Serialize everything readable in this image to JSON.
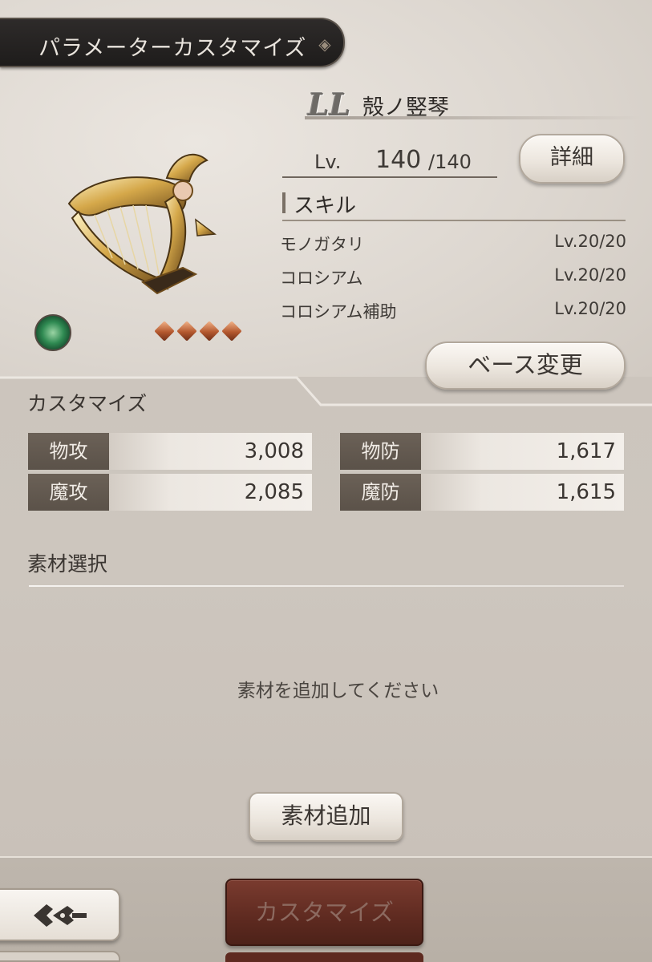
{
  "header": {
    "title": "パラメーターカスタマイズ",
    "icon": "diamond-emblem-icon"
  },
  "item": {
    "rank": "LL",
    "name": "殻ノ竪琴",
    "level_label": "Lv.",
    "level_current": "140",
    "level_max": "/140",
    "element": "wind",
    "stars": 4
  },
  "buttons": {
    "detail": "詳細",
    "base_change": "ベース変更",
    "add_material": "素材追加",
    "customize": "カスタマイズ"
  },
  "skills": {
    "title": "スキル",
    "rows": [
      {
        "name": "モノガタリ",
        "level": "Lv.20/20"
      },
      {
        "name": "コロシアム",
        "level": "Lv.20/20"
      },
      {
        "name": "コロシアム補助",
        "level": "Lv.20/20"
      }
    ]
  },
  "customize": {
    "title": "カスタマイズ",
    "stats": [
      {
        "label": "物攻",
        "value": "3,008"
      },
      {
        "label": "物防",
        "value": "1,617"
      },
      {
        "label": "魔攻",
        "value": "2,085"
      },
      {
        "label": "魔防",
        "value": "1,615"
      }
    ]
  },
  "materials": {
    "title": "素材選択",
    "empty_message": "素材を追加してください"
  },
  "colors": {
    "accent_dark": "#1e1c1b",
    "customize_button": "#5e2a20",
    "stat_label_bg": "#5b5249",
    "star": "#b4582e",
    "element_orb": "#2f8a52"
  }
}
